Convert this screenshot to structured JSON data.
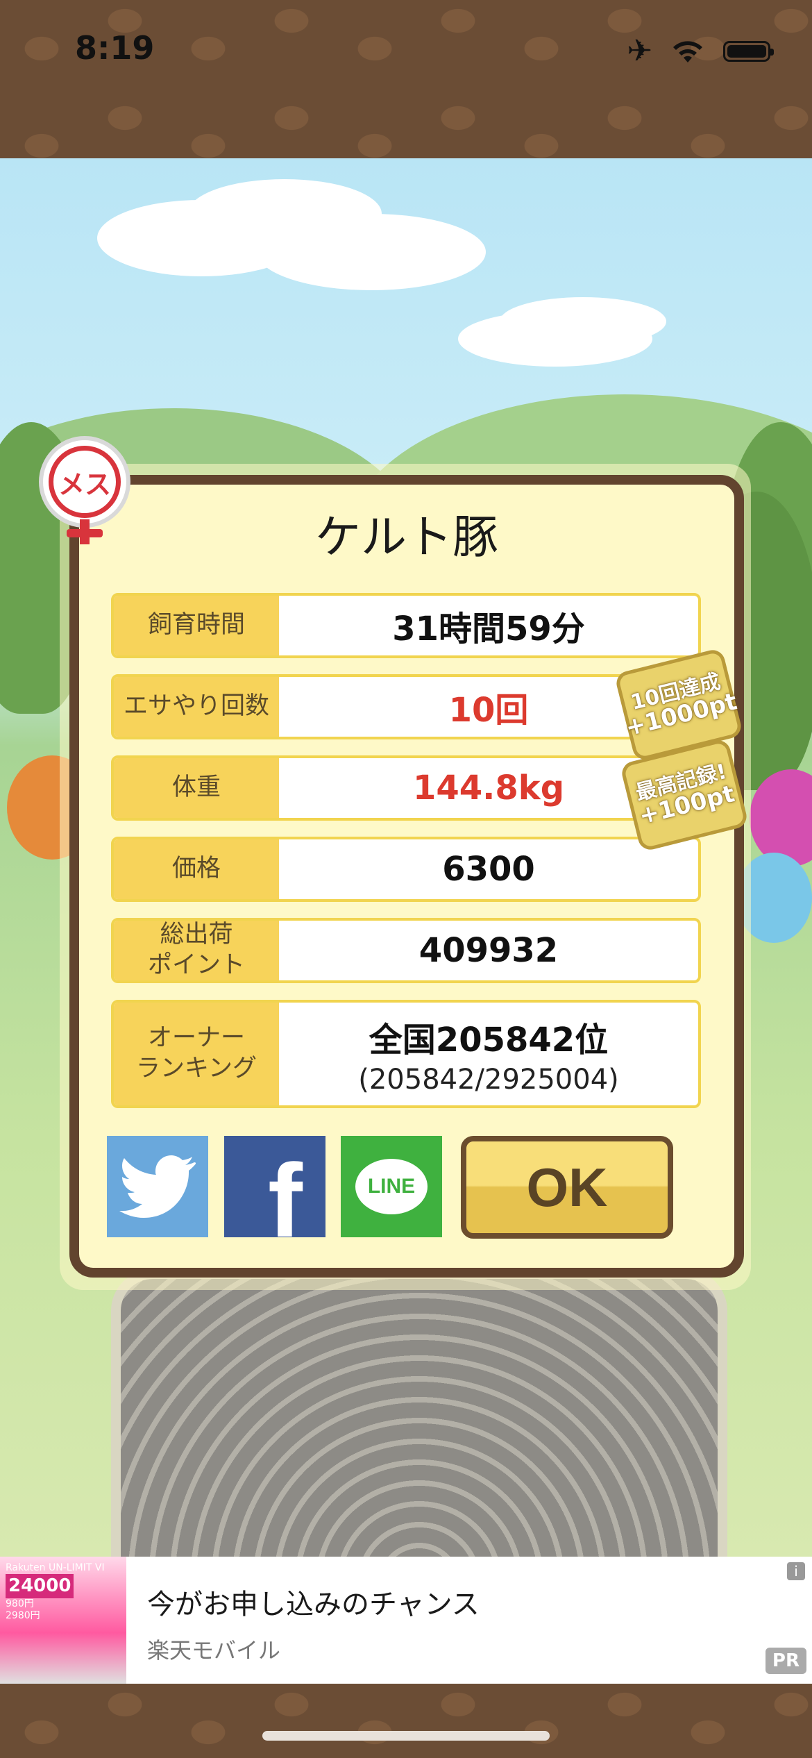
{
  "status_bar": {
    "time": "8:19",
    "icons": [
      "airplane-icon",
      "wifi-icon",
      "battery-icon"
    ]
  },
  "dialog": {
    "gender_badge": "メス",
    "pig_name": "ケルト豚",
    "stats": [
      {
        "label": "飼育時間",
        "value": "31時間59分",
        "highlight": false
      },
      {
        "label": "エサやり回数",
        "value": "10回",
        "highlight": true
      },
      {
        "label": "体重",
        "value": "144.8kg",
        "highlight": true
      },
      {
        "label": "価格",
        "value": "6300",
        "highlight": false
      },
      {
        "label": "総出荷ポイント",
        "value": "409932",
        "highlight": false
      },
      {
        "label": "オーナーランキング",
        "value": "全国205842位",
        "sub": "(205842/2925004)",
        "highlight": false
      }
    ],
    "bonuses": [
      {
        "line1": "10回達成",
        "line2": "+1000pt"
      },
      {
        "line1": "最高記録!",
        "line2": "+100pt"
      }
    ],
    "share": {
      "facebook": "f",
      "line": "LINE"
    },
    "ok_label": "OK"
  },
  "ad": {
    "title": "今がお申し込みのチャンス",
    "sponsor": "楽天モバイル",
    "pr_label": "PR",
    "info_label": "i",
    "image_text": {
      "brand": "Rakuten UN-LIMIT VI",
      "points": "24000",
      "price1": "980円",
      "price2": "2980円"
    }
  },
  "colors": {
    "frame_brown": "#62442e",
    "dialog_bg": "#fef9c8",
    "label_yellow": "#f7d35a",
    "highlight_red": "#dc3a2e",
    "twitter_blue": "#6aa8dc",
    "facebook_blue": "#3b5998",
    "line_green": "#3fb13f"
  }
}
